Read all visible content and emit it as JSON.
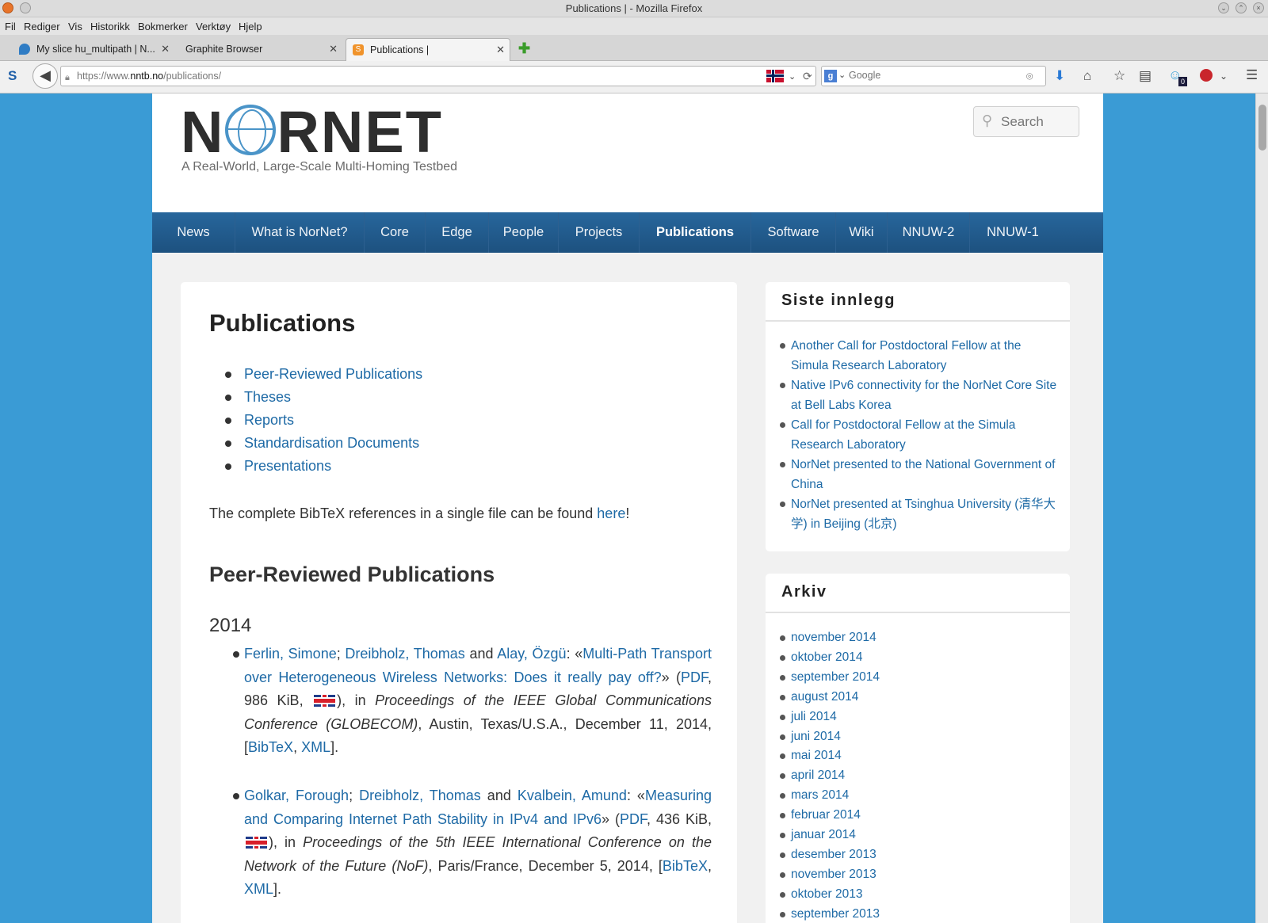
{
  "window": {
    "title": "Publications | - Mozilla Firefox"
  },
  "menu": [
    "Fil",
    "Rediger",
    "Vis",
    "Historikk",
    "Bokmerker",
    "Verktøy",
    "Hjelp"
  ],
  "tabs": [
    {
      "label": "My slice hu_multipath | N...",
      "active": false
    },
    {
      "label": "Graphite Browser",
      "active": false
    },
    {
      "label": "Publications |",
      "active": true
    }
  ],
  "address": {
    "prefix": "https://www.",
    "domain": "nntb.no",
    "path": "/publications/"
  },
  "browser_search": {
    "placeholder": "Google"
  },
  "notification_count": "0",
  "site": {
    "logo_text": "NORNET",
    "tagline": "A Real-World, Large-Scale Multi-Homing Testbed",
    "search_placeholder": "Search"
  },
  "nav": [
    "News",
    "What is NorNet?",
    "Core",
    "Edge",
    "People",
    "Projects",
    "Publications",
    "Software",
    "Wiki",
    "NNUW-2",
    "NNUW-1"
  ],
  "nav_current": "Publications",
  "content": {
    "title": "Publications",
    "toc": [
      "Peer-Reviewed Publications",
      "Theses",
      "Reports",
      "Standardisation Documents",
      "Presentations"
    ],
    "bibtex_text_before": "The complete BibTeX references in a single file can be found ",
    "bibtex_link": "here",
    "bibtex_text_after": "!",
    "section_heading": "Peer-Reviewed Publications",
    "year": "2014",
    "publications": [
      {
        "author1": "Ferlin, Simone",
        "sep1": "; ",
        "author2": "Dreibholz, Thomas",
        "sep2": " and ",
        "author3": "Alay, Özgü",
        "title": "Multi-Path Transport over Heterogeneous Wireless Networks: Does it really pay off?",
        "pdf": "PDF",
        "size": "986 KiB",
        "venue": "Proceedings of the IEEE Global Communications Conference (GLOBECOM)",
        "place_date": ", Austin, Texas/U.S.A., December 11, 2014, [",
        "bibtex": "BibTeX",
        "xml": "XML"
      },
      {
        "author1": "Golkar, Forough",
        "sep1": "; ",
        "author2": "Dreibholz, Thomas",
        "sep2": " and ",
        "author3": "Kvalbein, Amund",
        "title": "Measuring and Comparing Internet Path Stability in IPv4 and IPv6",
        "pdf": "PDF",
        "size": "436 KiB",
        "venue": "Proceedings of the 5th IEEE International Conference on the Network of the Future (NoF)",
        "place_date": ", Paris/France, December 5, 2014, [",
        "bibtex": "BibTeX",
        "xml": "XML"
      }
    ]
  },
  "sidebar": {
    "recent_title": "Siste innlegg",
    "recent": [
      "Another Call for Postdoctoral Fellow at the Simula Research Laboratory",
      "Native IPv6 connectivity for the NorNet Core Site at Bell Labs Korea",
      "Call for Postdoctoral Fellow at the Simula Research Laboratory",
      "NorNet presented to the National Government of China",
      "NorNet presented at Tsinghua University (清华大学) in Beijing (北京)"
    ],
    "archive_title": "Arkiv",
    "archive": [
      "november 2014",
      "oktober 2014",
      "september 2014",
      "august 2014",
      "juli 2014",
      "juni 2014",
      "mai 2014",
      "april 2014",
      "mars 2014",
      "februar 2014",
      "januar 2014",
      "desember 2013",
      "november 2013",
      "oktober 2013",
      "september 2013"
    ]
  },
  "colors": {
    "link": "#1e6aa6",
    "nav_bg": "#1d517f",
    "page_bg": "#3a9bd5"
  }
}
